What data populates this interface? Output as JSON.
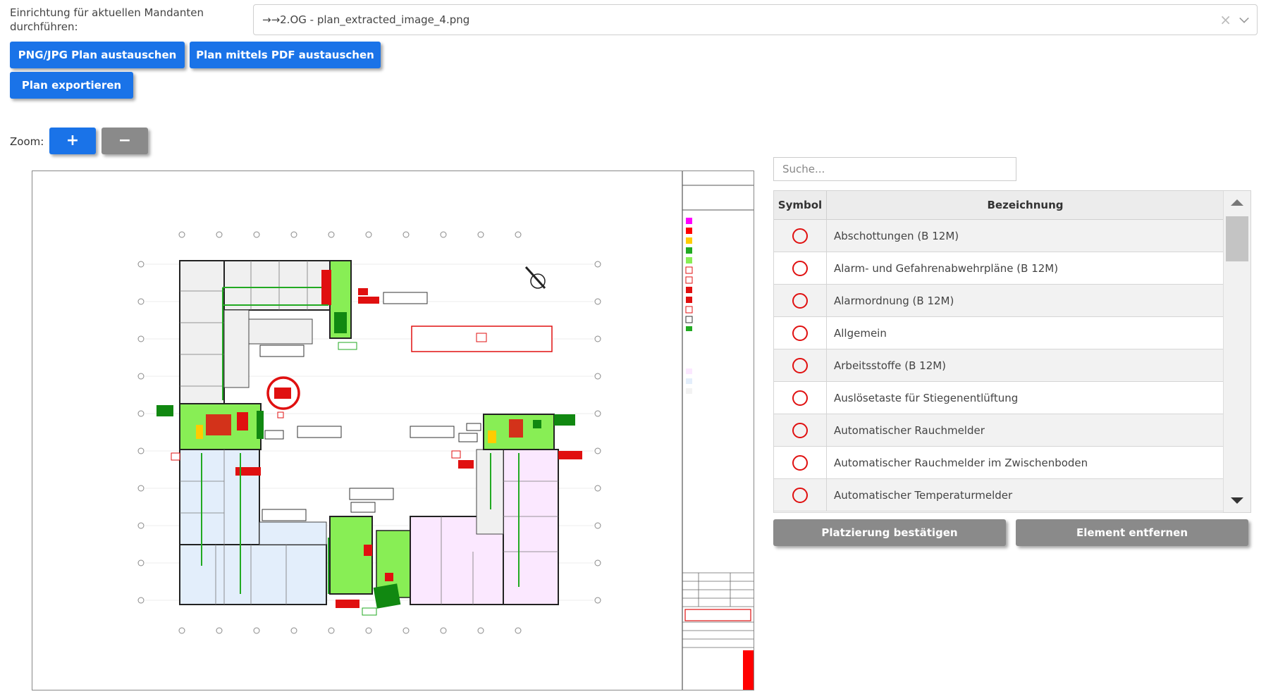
{
  "header": {
    "mandant_label": "Einrichtung für aktuellen Mandanten durchführen:",
    "select_value": "→→2.OG - plan_extracted_image_4.png",
    "select_clear": "×"
  },
  "toolbar": {
    "replace_png_label": "PNG/JPG Plan austauschen",
    "replace_pdf_label": "Plan mittels PDF austauschen",
    "export_label": "Plan exportieren"
  },
  "zoom": {
    "label": "Zoom:",
    "plus": "+",
    "minus": "−"
  },
  "search": {
    "placeholder": "Suche..."
  },
  "table": {
    "headers": {
      "symbol": "Symbol",
      "bezeichnung": "Bezeichnung"
    },
    "rows": [
      {
        "label": "Abschottungen (B 12M)"
      },
      {
        "label": "Alarm- und Gefahrenabwehrpläne (B 12M)"
      },
      {
        "label": "Alarmordnung (B 12M)"
      },
      {
        "label": "Allgemein"
      },
      {
        "label": "Arbeitsstoffe (B 12M)"
      },
      {
        "label": "Auslösetaste für Stiegenentlüftung"
      },
      {
        "label": "Automatischer Rauchmelder"
      },
      {
        "label": "Automatischer Rauchmelder im Zwischenboden"
      },
      {
        "label": "Automatischer Temperaturmelder"
      }
    ],
    "symbol_color": "#e01010"
  },
  "actions": {
    "confirm_label": "Platzierung bestätigen",
    "remove_label": "Element entfernen"
  },
  "colors": {
    "primary": "#1a73e8",
    "secondary": "#8a8a8a",
    "marker": "#e01010"
  }
}
